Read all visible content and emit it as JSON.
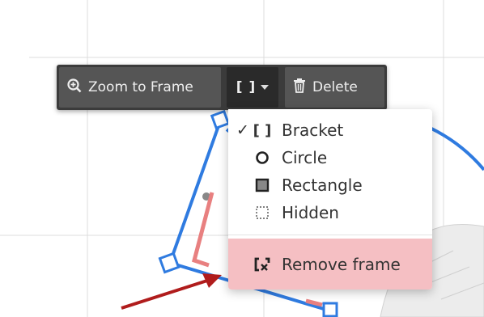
{
  "toolbar": {
    "zoom_label": "Zoom to Frame",
    "frame_icon_glyph": "[ ]",
    "delete_label": "Delete",
    "zoom_icon": "zoom-in-icon",
    "delete_icon": "trash-icon"
  },
  "frame_menu": {
    "items": [
      {
        "label": "Bracket",
        "icon": "bracket-icon",
        "glyph": "[ ]",
        "selected": true,
        "check": "✓"
      },
      {
        "label": "Circle",
        "icon": "circle-icon",
        "selected": false
      },
      {
        "label": "Rectangle",
        "icon": "rectangle-icon",
        "selected": false
      },
      {
        "label": "Hidden",
        "icon": "dashed-square-icon",
        "selected": false
      }
    ],
    "remove": {
      "label": "Remove frame",
      "icon": "remove-frame-icon"
    }
  },
  "colors": {
    "toolbar_bg": "#3b3b3b",
    "button_bg": "#555555",
    "frame_blue": "#2f7be0",
    "bracket_red": "#e88080",
    "arrow_red": "#b01c1c",
    "remove_bg": "#f5bfc3"
  }
}
